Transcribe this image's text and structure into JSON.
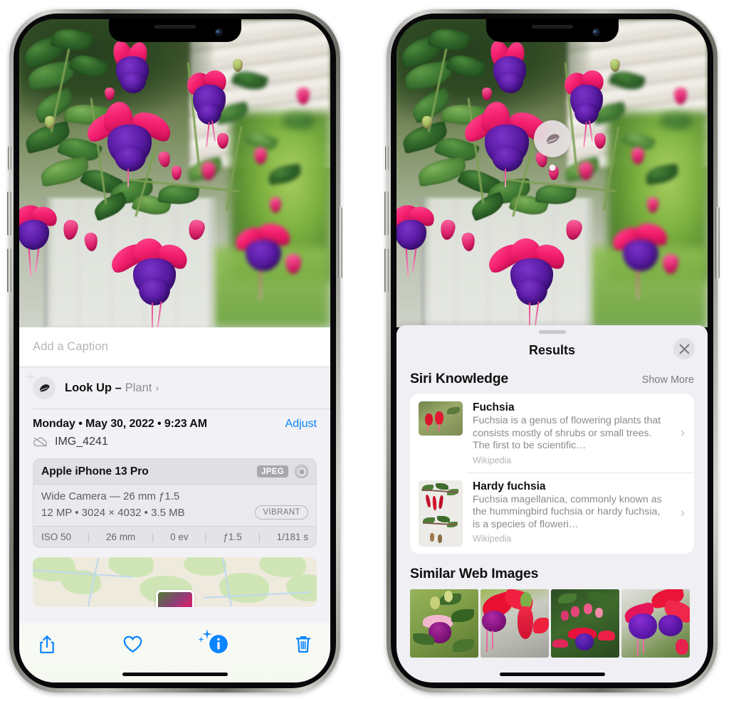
{
  "colors": {
    "accent_blue": "#0b84ff",
    "sheet_bg": "#f2f2f6",
    "results_bg": "#f0eff4",
    "flower_pink": "#f5206f",
    "flower_purple": "#5a1ca5",
    "muted_text": "#8e8e93"
  },
  "left_phone": {
    "caption": {
      "placeholder": "Add a Caption",
      "value": ""
    },
    "lookup": {
      "icon": "leaf-icon",
      "sparkle_icon": "sparkles-icon",
      "title": "Look Up –",
      "subject": "Plant",
      "chevron": "›"
    },
    "meta": {
      "date": "Monday • May 30, 2022 • 9:23 AM",
      "adjust_label": "Adjust",
      "cloud_icon": "icloud-slash-icon",
      "filename": "IMG_4241"
    },
    "exif": {
      "device": "Apple iPhone 13 Pro",
      "format_badge": "JPEG",
      "raw_icon": "raw-circle-icon",
      "lens": "Wide Camera — 26 mm ƒ1.5",
      "size": "12 MP • 3024 × 4032 • 3.5 MB",
      "style_badge": "VIBRANT",
      "settings": [
        {
          "label": "ISO 50"
        },
        {
          "label": "26 mm"
        },
        {
          "label": "0 ev"
        },
        {
          "label": "ƒ1.5"
        },
        {
          "label": "1/181 s"
        }
      ],
      "separator": "|"
    },
    "toolbar": [
      {
        "name": "share-icon",
        "label": "Share"
      },
      {
        "name": "heart-icon",
        "label": "Favorite"
      },
      {
        "name": "info-sparkle-icon",
        "label": "Info"
      },
      {
        "name": "trash-icon",
        "label": "Delete"
      }
    ]
  },
  "right_phone": {
    "vlu_badge": {
      "icon": "leaf-icon"
    },
    "sheet": {
      "grabber": "drag-handle",
      "title": "Results",
      "close_icon": "close-icon"
    },
    "siri_knowledge": {
      "title": "Siri Knowledge",
      "action": "Show More",
      "items": [
        {
          "title": "Fuchsia",
          "description": "Fuchsia is a genus of flowering plants that consists mostly of shrubs or small trees. The first to be scientific…",
          "source": "Wikipedia",
          "chevron": "›"
        },
        {
          "title": "Hardy fuchsia",
          "description": "Fuchsia magellanica, commonly known as the hummingbird fuchsia or hardy fuchsia, is a species of floweri…",
          "source": "Wikipedia",
          "chevron": "›"
        }
      ]
    },
    "similar_web_images": {
      "title": "Similar Web Images",
      "tiles": [
        {
          "alt": "fuchsia-thumbnail-1"
        },
        {
          "alt": "fuchsia-thumbnail-2"
        },
        {
          "alt": "fuchsia-thumbnail-3"
        },
        {
          "alt": "fuchsia-thumbnail-4"
        }
      ]
    }
  }
}
